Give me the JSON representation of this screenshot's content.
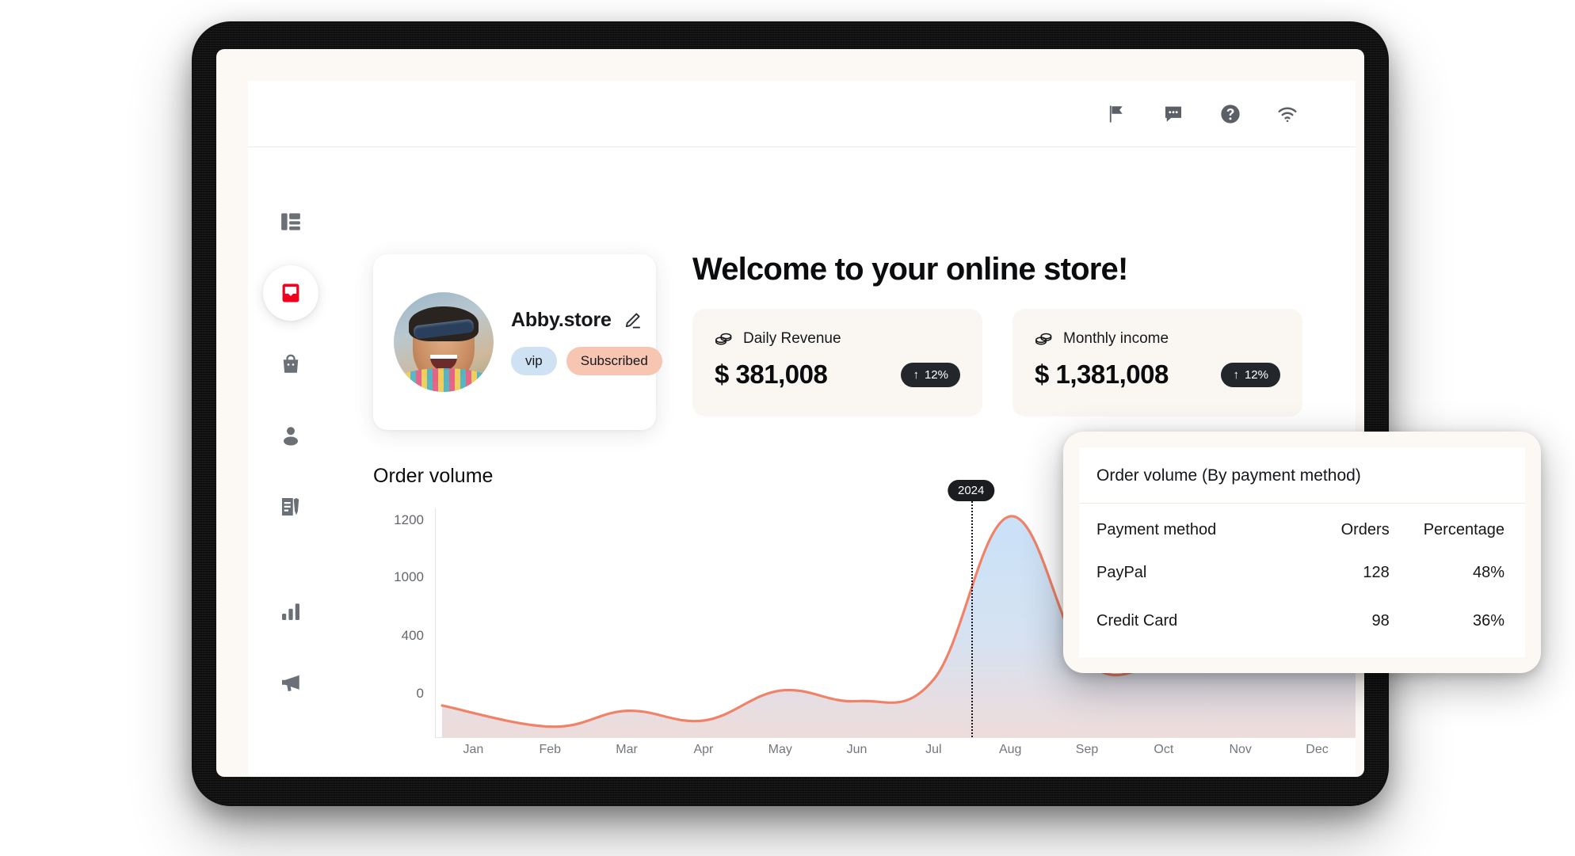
{
  "header": {
    "icons": [
      {
        "name": "flag-icon",
        "label": "Flag"
      },
      {
        "name": "chat-icon",
        "label": "Messages"
      },
      {
        "name": "help-icon",
        "label": "Help"
      },
      {
        "name": "wifi-icon",
        "label": "Connection"
      }
    ]
  },
  "sidebar": {
    "items": [
      {
        "name": "dashboard",
        "label": "Dashboard",
        "active": false
      },
      {
        "name": "inbox",
        "label": "Inbox",
        "active": true
      },
      {
        "name": "products",
        "label": "Products",
        "active": false
      },
      {
        "name": "customers",
        "label": "Customers",
        "active": false
      },
      {
        "name": "content",
        "label": "Content",
        "active": false
      },
      {
        "name": "analytics",
        "label": "Analytics",
        "active": false
      },
      {
        "name": "marketing",
        "label": "Marketing",
        "active": false
      }
    ]
  },
  "profile": {
    "store_name": "Abby.store",
    "edit_label": "Edit",
    "badges": [
      {
        "text": "vip",
        "color": "#CFE2F3"
      },
      {
        "text": "Subscribed",
        "color": "#F7C6B2"
      }
    ]
  },
  "main": {
    "welcome_title": "Welcome to your online store!",
    "stats": [
      {
        "label": "Daily Revenue",
        "value": "$ 381,008",
        "trend": "12%",
        "trend_arrow": "↑"
      },
      {
        "label": "Monthly income",
        "value": "$ 1,381,008",
        "trend": "12%",
        "trend_arrow": "↑"
      }
    ]
  },
  "chart_section": {
    "title": "Order volume",
    "marker_label": "2024"
  },
  "chart_data": {
    "type": "area",
    "title": "Order volume",
    "xlabel": "",
    "ylabel": "",
    "categories": [
      "Jan",
      "Feb",
      "Mar",
      "Apr",
      "May",
      "Jun",
      "Jul",
      "Aug",
      "Sep",
      "Oct",
      "Nov",
      "Dec"
    ],
    "values": [
      180,
      60,
      150,
      95,
      265,
      205,
      330,
      1255,
      430,
      405,
      395,
      390
    ],
    "ytick_labels": [
      "1200",
      "1000",
      "400",
      "0"
    ],
    "ylim": [
      0,
      1300
    ],
    "grid": false,
    "legend": "none",
    "annotations": [
      {
        "label": "2024",
        "at_category": "Aug"
      }
    ],
    "line_color": "#F08268",
    "fill_gradient": [
      "#CFE4F7",
      "#EFDCDC"
    ]
  },
  "popup": {
    "title": "Order volume (By payment method)",
    "columns": [
      "Payment method",
      "Orders",
      "Percentage"
    ],
    "rows": [
      {
        "method": "PayPal",
        "orders": "128",
        "percentage": "48%"
      },
      {
        "method": "Credit Card",
        "orders": "98",
        "percentage": "36%"
      }
    ]
  }
}
